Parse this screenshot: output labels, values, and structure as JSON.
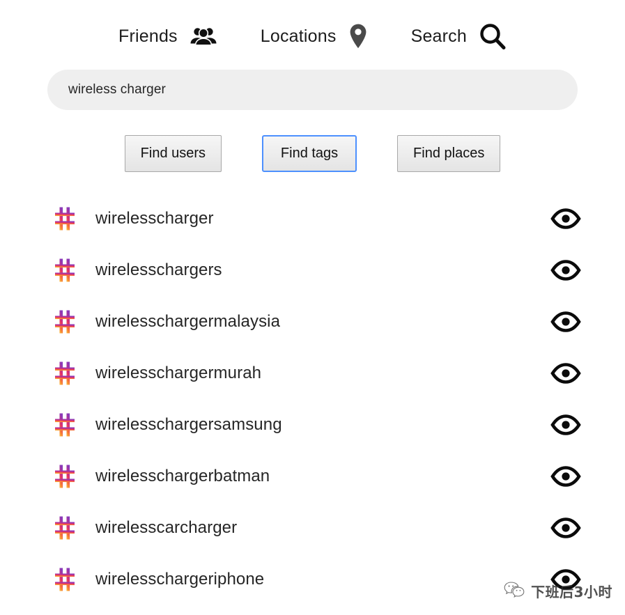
{
  "nav": {
    "items": [
      {
        "label": "Friends",
        "icon": "people-group-icon"
      },
      {
        "label": "Locations",
        "icon": "map-pin-icon"
      },
      {
        "label": "Search",
        "icon": "magnifier-icon"
      }
    ]
  },
  "search": {
    "value": "wireless charger",
    "placeholder": "Search"
  },
  "filters": {
    "buttons": [
      {
        "label": "Find users",
        "focused": false
      },
      {
        "label": "Find tags",
        "focused": true
      },
      {
        "label": "Find places",
        "focused": false
      }
    ],
    "focus_color": "#4d90fe"
  },
  "results": {
    "row_icon": "hashtag-icon",
    "row_action_icon": "eye-icon",
    "tags": [
      {
        "name": "wirelesscharger"
      },
      {
        "name": "wirelesschargers"
      },
      {
        "name": "wirelesschargermalaysia"
      },
      {
        "name": "wirelesschargermurah"
      },
      {
        "name": "wirelesschargersamsung"
      },
      {
        "name": "wirelesschargerbatman"
      },
      {
        "name": "wirelesscarcharger"
      },
      {
        "name": "wirelesschargeriphone"
      }
    ]
  },
  "watermark": {
    "text": "下班后3小时",
    "icon": "wechat-icon"
  },
  "colors": {
    "hash_gradient_top": "#8a3ab9",
    "hash_gradient_mid": "#e1306c",
    "hash_gradient_bottom": "#f9a13a",
    "search_background": "#efefef",
    "text": "#262626"
  }
}
